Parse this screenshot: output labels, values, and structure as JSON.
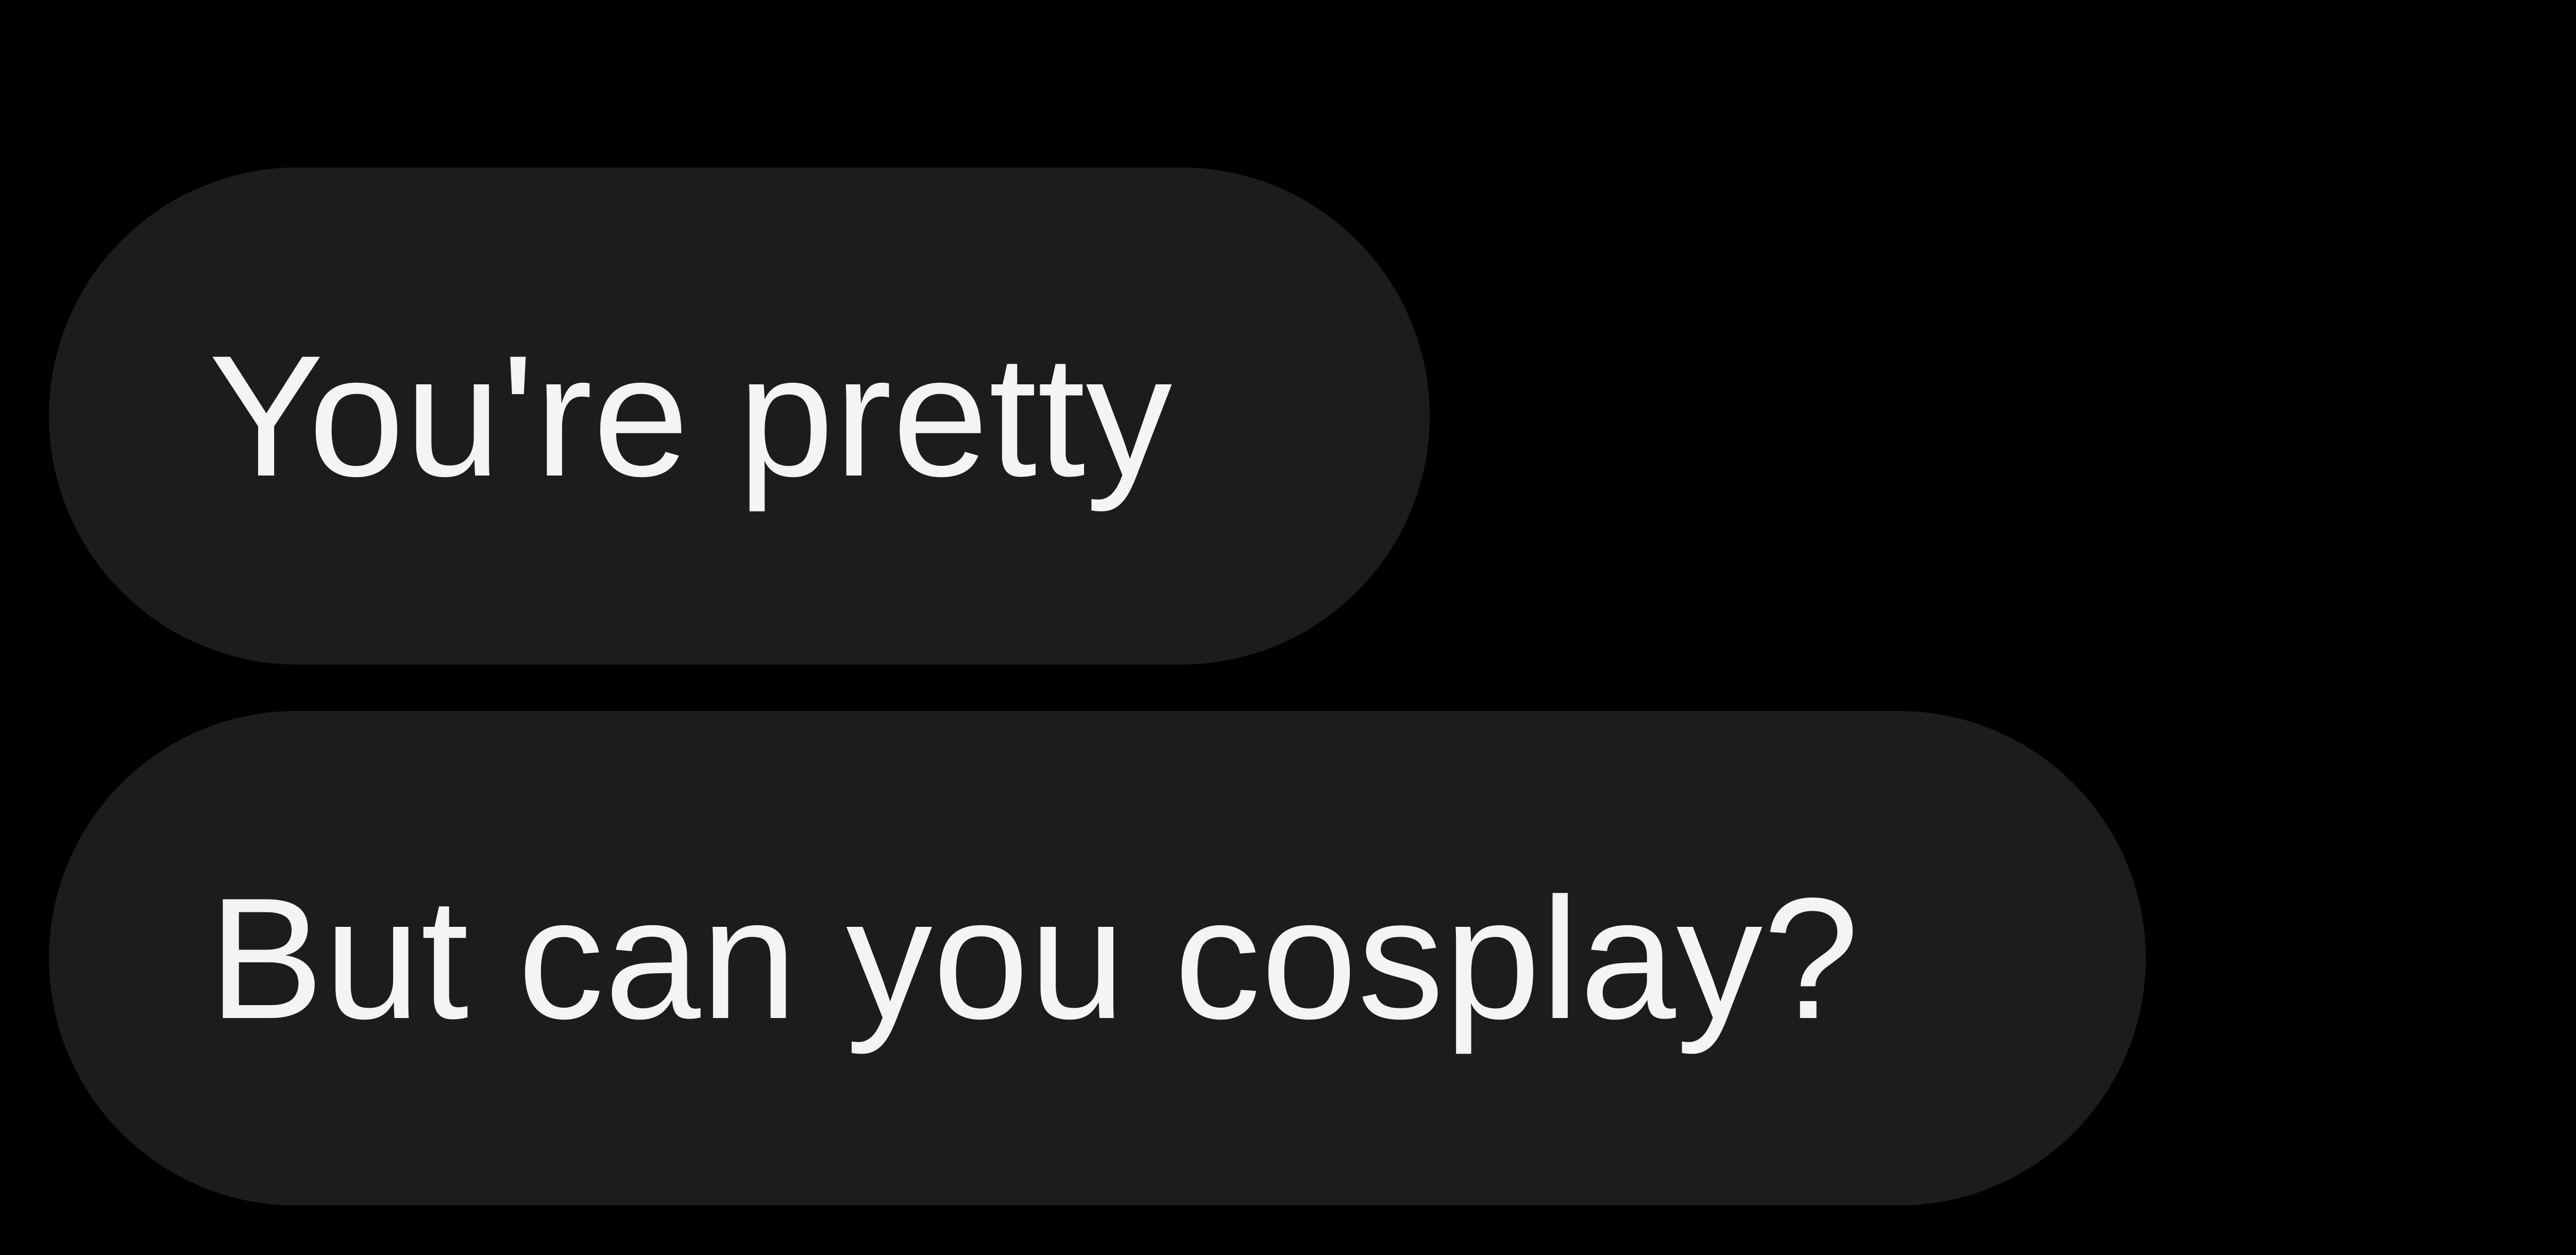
{
  "conversation": {
    "messages": [
      {
        "text": "You're pretty"
      },
      {
        "text": "But can you cosplay?"
      }
    ]
  },
  "colors": {
    "background": "#000000",
    "bubble": "#1c1c1c",
    "text": "#f4f4f4"
  }
}
